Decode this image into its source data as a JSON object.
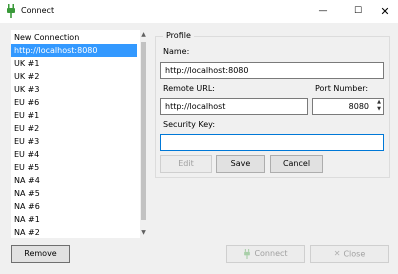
{
  "window": {
    "title": "Connect",
    "icon": "plug-icon",
    "minimize_glyph": "—",
    "maximize_glyph": "☐",
    "close_glyph": "✕"
  },
  "connections": {
    "items": [
      "New Connection",
      "http://localhost:8080",
      "UK #1",
      "UK #2",
      "UK #3",
      "EU #6",
      "EU #1",
      "EU #2",
      "EU #3",
      "EU #4",
      "EU #5",
      "NA #4",
      "NA #5",
      "NA #6",
      "NA #1",
      "NA #2"
    ],
    "selected_index": 1,
    "remove_label": "Remove"
  },
  "profile": {
    "group_title": "Profile",
    "name_label": "Name:",
    "name_value": "http://localhost:8080",
    "url_label": "Remote URL:",
    "url_value": "http://localhost",
    "port_label": "Port Number:",
    "port_value": "8080",
    "key_label": "Security Key:",
    "key_value": "",
    "edit_label": "Edit",
    "save_label": "Save",
    "cancel_label": "Cancel"
  },
  "footer": {
    "connect_label": "Connect",
    "close_label": "Close"
  },
  "colors": {
    "selection": "#3399ff",
    "focus_border": "#0078d7",
    "icon_green": "#3a9a3a"
  }
}
